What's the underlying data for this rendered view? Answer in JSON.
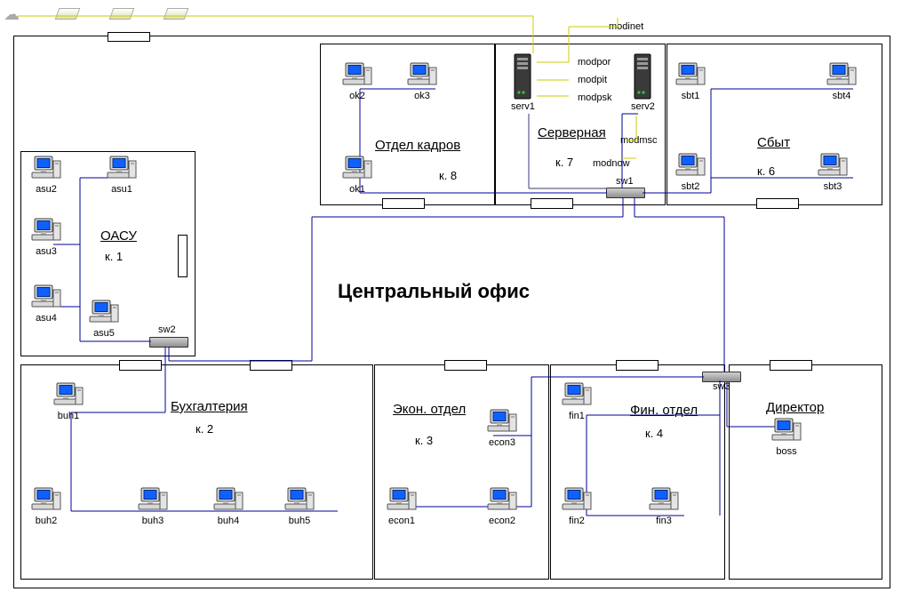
{
  "title": "Центральный офис",
  "modem_labels": {
    "modinet": "modinet",
    "modpor": "modpor",
    "modpit": "modpit",
    "modpsk": "modpsk",
    "modmsc": "modmsc",
    "modnow": "modnow"
  },
  "switches": {
    "sw1": "sw1",
    "sw2": "sw2",
    "sw3": "sw3"
  },
  "servers": {
    "serv1": "serv1",
    "serv2": "serv2"
  },
  "rooms": {
    "oasu": {
      "label": "ОАСУ",
      "num": "к. 1"
    },
    "buh": {
      "label": "Бухгалтерия",
      "num": "к. 2"
    },
    "econ": {
      "label": "Экон. отдел",
      "num": "к. 3"
    },
    "fin": {
      "label": "Фин. отдел",
      "num": "к. 4"
    },
    "sbt": {
      "label": "Сбыт",
      "num": "к. 6"
    },
    "srv": {
      "label": "Серверная",
      "num": "к. 7"
    },
    "ok": {
      "label": "Отдел кадров",
      "num": "к. 8"
    },
    "dir": {
      "label": "Директор",
      "num": ""
    }
  },
  "hosts": {
    "asu1": "asu1",
    "asu2": "asu2",
    "asu3": "asu3",
    "asu4": "asu4",
    "asu5": "asu5",
    "buh1": "buh1",
    "buh2": "buh2",
    "buh3": "buh3",
    "buh4": "buh4",
    "buh5": "buh5",
    "econ1": "econ1",
    "econ2": "econ2",
    "econ3": "econ3",
    "fin1": "fin1",
    "fin2": "fin2",
    "fin3": "fin3",
    "sbt1": "sbt1",
    "sbt2": "sbt2",
    "sbt3": "sbt3",
    "sbt4": "sbt4",
    "ok1": "ok1",
    "ok2": "ok2",
    "ok3": "ok3",
    "boss": "boss"
  }
}
